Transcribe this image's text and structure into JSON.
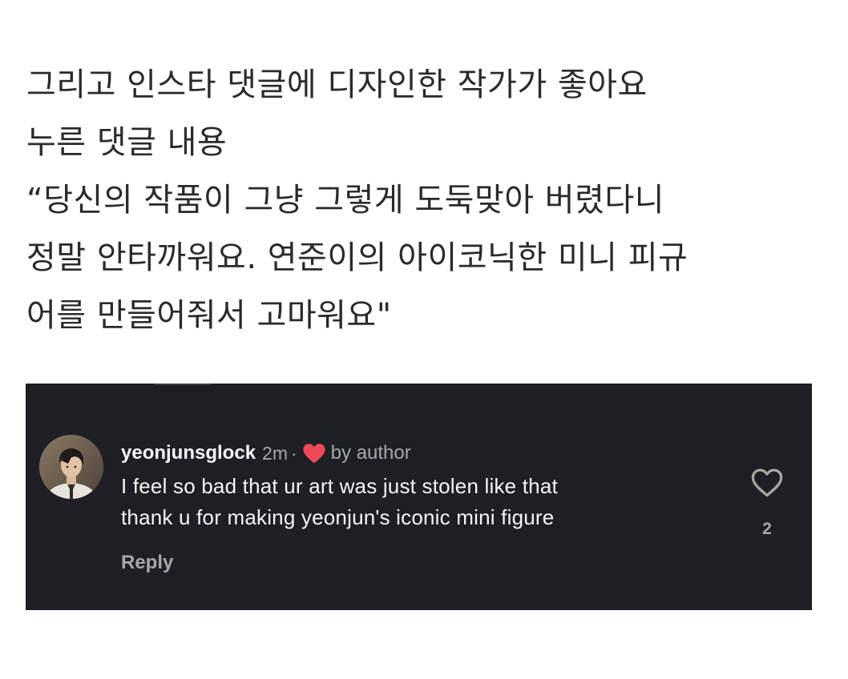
{
  "post": {
    "lines": [
      "그리고 인스타 댓글에 디자인한 작가가 좋아요",
      "누른 댓글 내용",
      "“당신의 작품이 그냥 그렇게 도둑맞아 버렸다니",
      "정말 안타까워요. 연준이의 아이코닉한 미니 피규",
      "어를 만들어줘서 고마워요\""
    ]
  },
  "comment": {
    "username": "yeonjunsglock",
    "time": "2m",
    "separator": "·",
    "liked_by_label": "by author",
    "text_lines": [
      "I feel so bad that ur art was just stolen like that",
      "thank u for making yeonjun's iconic mini figure"
    ],
    "reply_label": "Reply",
    "like_count": "2"
  },
  "icons": {
    "author_like": "red-heart-icon",
    "like_button": "heart-outline-icon",
    "avatar": "profile-avatar"
  },
  "colors": {
    "panel_background": "#1d1f24",
    "heart_red": "#ed4956",
    "muted_text": "#a8a8a8"
  }
}
